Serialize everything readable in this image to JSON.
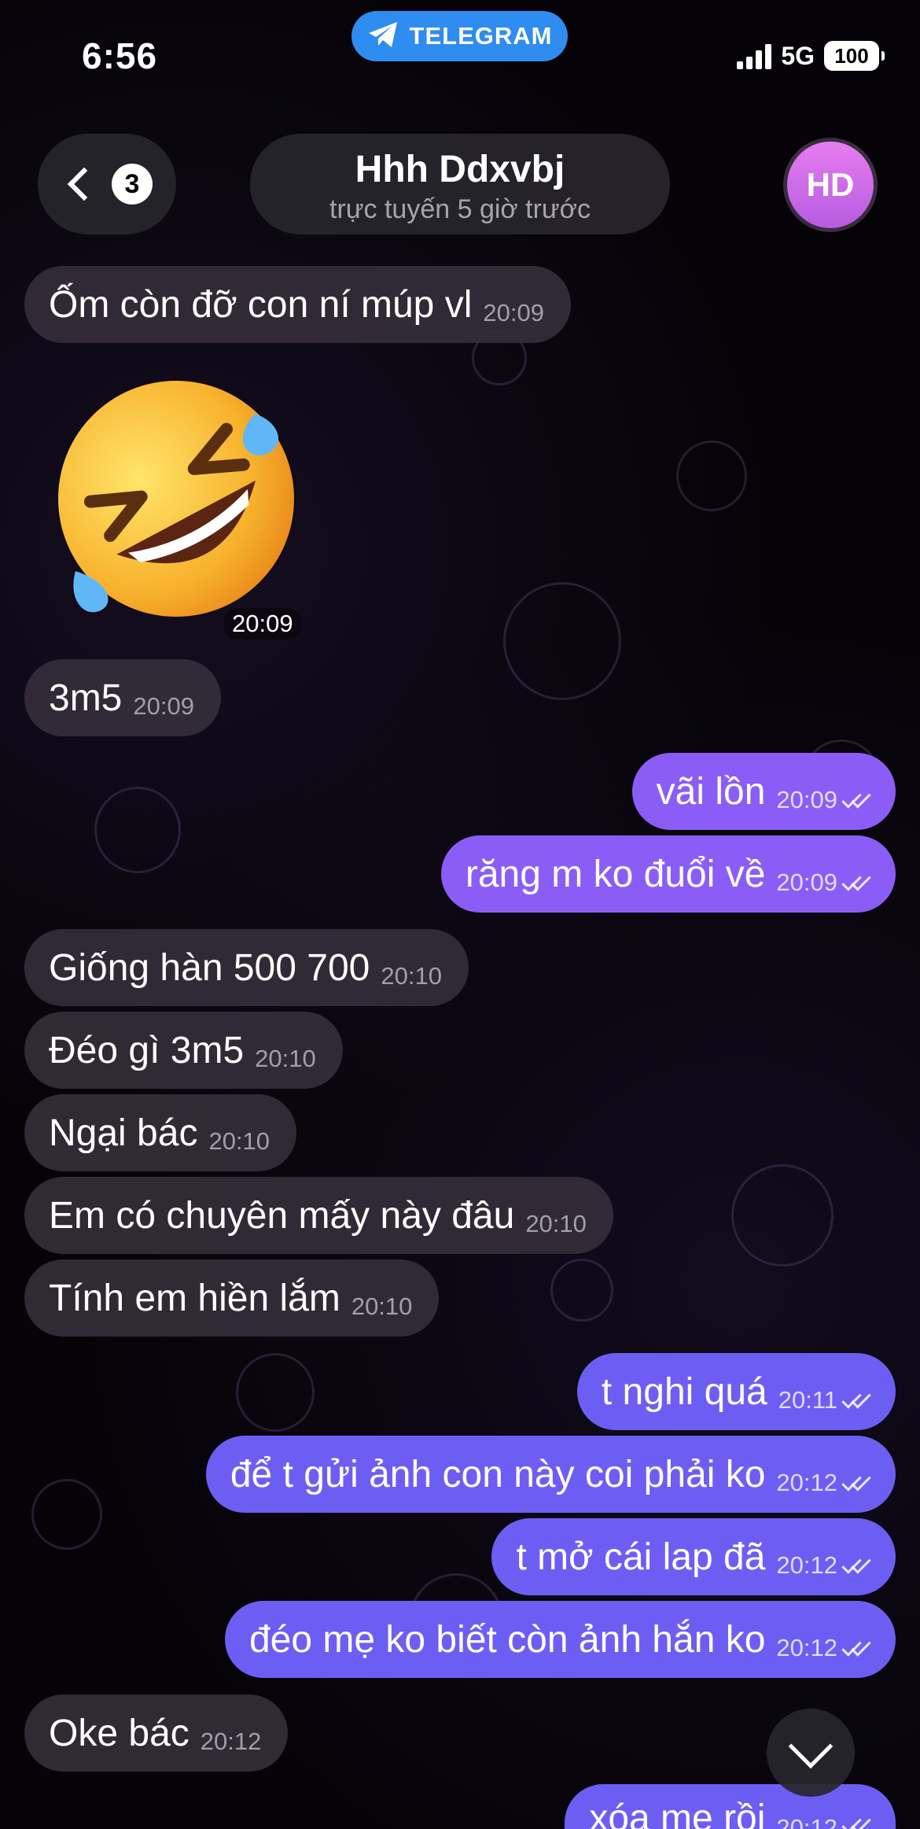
{
  "status_bar": {
    "time": "6:56",
    "app_pill": "TELEGRAM",
    "network": "5G",
    "battery": "100"
  },
  "header": {
    "back_badge": "3",
    "chat_name": "Hhh Ddxvbj",
    "chat_status": "trực tuyến 5 giờ trước",
    "avatar_initials": "HD",
    "avatar_color": "#c96ae6"
  },
  "colors": {
    "incoming_bubble": "#342e3a",
    "outgoing_bubble": "#8a5ef6",
    "outgoing_bubble_alt": "#6d5ef3",
    "telegram_blue": "#2f8cf0"
  },
  "sticker": {
    "icon": "rolling-on-floor-laughing-emoji",
    "time": "20:09"
  },
  "messages": [
    {
      "dir": "in",
      "text": "Ốm còn đỡ con ní múp vl",
      "time": "20:09"
    },
    {
      "dir": "in",
      "text": "3m5",
      "time": "20:09"
    },
    {
      "dir": "out",
      "text": "vãi lồn",
      "time": "20:09"
    },
    {
      "dir": "out",
      "text": "răng m ko đuổi về",
      "time": "20:09"
    },
    {
      "dir": "in",
      "text": "Giống hàn 500 700",
      "time": "20:10"
    },
    {
      "dir": "in",
      "text": "Đéo gì 3m5",
      "time": "20:10"
    },
    {
      "dir": "in",
      "text": "Ngại bác",
      "time": "20:10"
    },
    {
      "dir": "in",
      "text": "Em có chuyên mấy này đâu",
      "time": "20:10"
    },
    {
      "dir": "in",
      "text": "Tính em hiền lắm",
      "time": "20:10"
    },
    {
      "dir": "out",
      "text": "t nghi quá",
      "time": "20:11"
    },
    {
      "dir": "out",
      "text": "để t gửi ảnh con này coi phải ko",
      "time": "20:12"
    },
    {
      "dir": "out",
      "text": "t mở cái lap đã",
      "time": "20:12"
    },
    {
      "dir": "out",
      "text": "đéo mẹ ko biết còn ảnh hắn ko",
      "time": "20:12"
    },
    {
      "dir": "in",
      "text": "Oke bác",
      "time": "20:12"
    },
    {
      "dir": "out",
      "text": "xóa mẹ rồi",
      "time": "20:12"
    }
  ]
}
